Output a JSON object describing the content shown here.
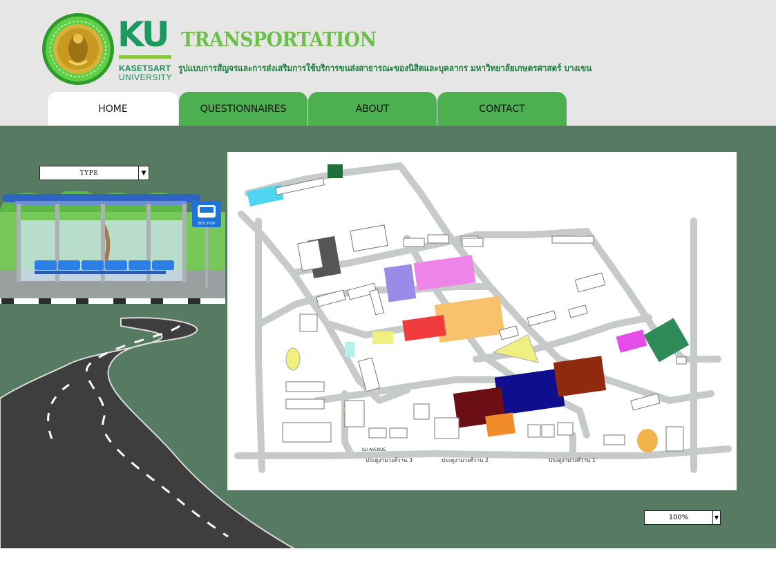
{
  "header": {
    "ku_letters": "KU",
    "ku_name_line1": "KASETSART",
    "ku_name_line2": "UNIVERSITY",
    "title": "TRANSPORTATION",
    "subtitle": "รูปแบบการสัญจรและการส่งเสริมการใช้บริการขนส่งสาธารณะของนิสิตและบุคลากร มหาวิทยาลัยเกษตรศาสตร์ บางเขน"
  },
  "nav": {
    "tabs": [
      {
        "label": "HOME",
        "active": true
      },
      {
        "label": "QUESTIONNAIRES",
        "active": false
      },
      {
        "label": "ABOUT",
        "active": false
      },
      {
        "label": "CONTACT",
        "active": false
      }
    ]
  },
  "filters": {
    "type_select": {
      "value": "TYPE",
      "arrow": "▼"
    },
    "zoom_select": {
      "value": "100%",
      "arrow": "▼"
    }
  },
  "map": {
    "gate_labels": [
      "ประตูงามวงศ์วาน 3",
      "ประตูงามวงศ์วาน 2",
      "ประตูงามวงศ์วาน 1"
    ],
    "road_label": "KU AVENUE"
  },
  "illustration": {
    "bus_stop_sign": "BUS STOP"
  },
  "colors": {
    "header_bg": "#e6e6e6",
    "main_bg": "#567b62",
    "tab_green": "#4caf50",
    "title_green": "#6cc04a",
    "road_gray": "#c6cbc9"
  },
  "icons": {
    "seal": "university-seal-icon",
    "bus": "bus-icon"
  }
}
